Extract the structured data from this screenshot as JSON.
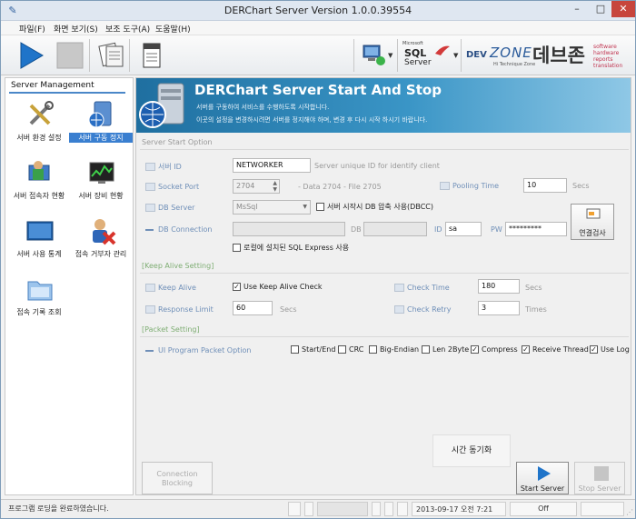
{
  "window": {
    "title": "DERChart Server Version 1.0.0.39554"
  },
  "menu": [
    "파일(F)",
    "화면 보기(S)",
    "보조 도구(A)",
    "도움말(H)"
  ],
  "toolbar": {
    "sql_small": "Microsoft",
    "sql_big": "SQL",
    "sql_server": "Server",
    "dz_dev": "DEV",
    "dz_zone": "ZONE",
    "dz_sub": "Hi Technique Zone",
    "dz_kr": "데브존",
    "dz_tags": [
      "software",
      "hardware",
      "reports",
      "translation"
    ]
  },
  "sidebar": {
    "title": "Server Management",
    "items": [
      {
        "label": "서버 환경 설정",
        "icon": "tools-icon"
      },
      {
        "label": "서버 구동 정지",
        "icon": "server-globe-icon",
        "selected": true
      },
      {
        "label": "서버 접속자 현황",
        "icon": "users-monitor-icon"
      },
      {
        "label": "서버 장비 현황",
        "icon": "equipment-monitor-icon"
      },
      {
        "label": "서버 사용 통계",
        "icon": "statistics-screen-icon"
      },
      {
        "label": "접속 거부자 관리",
        "icon": "blocked-user-icon"
      },
      {
        "label": "접속 기록 조회",
        "icon": "log-folder-icon"
      }
    ]
  },
  "banner": {
    "title": "DERChart Server Start And Stop",
    "line1": "서버를 구동하여 서비스를 수행하도록 시작합니다.",
    "line2": "이곳의 설정을 변경하시려면 서버를 정지해야 하며, 변경 후 다시 시작 하시기 바랍니다."
  },
  "start_option": {
    "section": "Server Start Option",
    "server_id": {
      "label": "서버 ID",
      "value": "NETWORKER",
      "hint": "Server unique ID for identify client"
    },
    "socket_port": {
      "label": "Socket Port",
      "value": "2704",
      "hint": "- Data 2704 - File 2705"
    },
    "pooling_time": {
      "label": "Pooling Time",
      "value": "10",
      "unit": "Secs"
    },
    "db_server": {
      "label": "DB Server",
      "value": "MsSql",
      "compress_label": "서버 시작시 DB 압축 사용(DBCC)"
    },
    "db_connection": {
      "label": "DB Connection",
      "db_label": "DB",
      "id_label": "ID",
      "id_value": "sa",
      "pw_label": "PW",
      "pw_value": "*********"
    },
    "sql_express_label": "로컬에 설치된 SQL Express 사용",
    "db_test_label": "연결검사"
  },
  "keep_alive": {
    "section": "[Keep Alive Setting]",
    "label": "Keep Alive",
    "use_label": "Use Keep Alive Check",
    "check_time": {
      "label": "Check Time",
      "value": "180",
      "unit": "Secs"
    },
    "response_limit": {
      "label": "Response Limit",
      "value": "60",
      "unit": "Secs"
    },
    "check_retry": {
      "label": "Check Retry",
      "value": "3",
      "unit": "Times"
    }
  },
  "packet": {
    "section": "[Packet Setting]",
    "label": "UI Program Packet Option",
    "options": [
      {
        "label": "Start/End",
        "checked": false
      },
      {
        "label": "CRC",
        "checked": false
      },
      {
        "label": "Big-Endian",
        "checked": false
      },
      {
        "label": "Len 2Byte",
        "checked": false
      },
      {
        "label": "Compress",
        "checked": true
      },
      {
        "label": "Receive Thread",
        "checked": true
      },
      {
        "label": "Use Log",
        "checked": true
      }
    ]
  },
  "actions": {
    "time_sync": "시간 동기화",
    "connection_blocking": [
      "Connection",
      "Blocking"
    ],
    "start_server": "Start Server",
    "stop_server": "Stop Server"
  },
  "status": {
    "message": "프로그램 로딩을 완료하였습니다.",
    "datetime": "2013-09-17 오전 7:21",
    "state": "Off"
  }
}
